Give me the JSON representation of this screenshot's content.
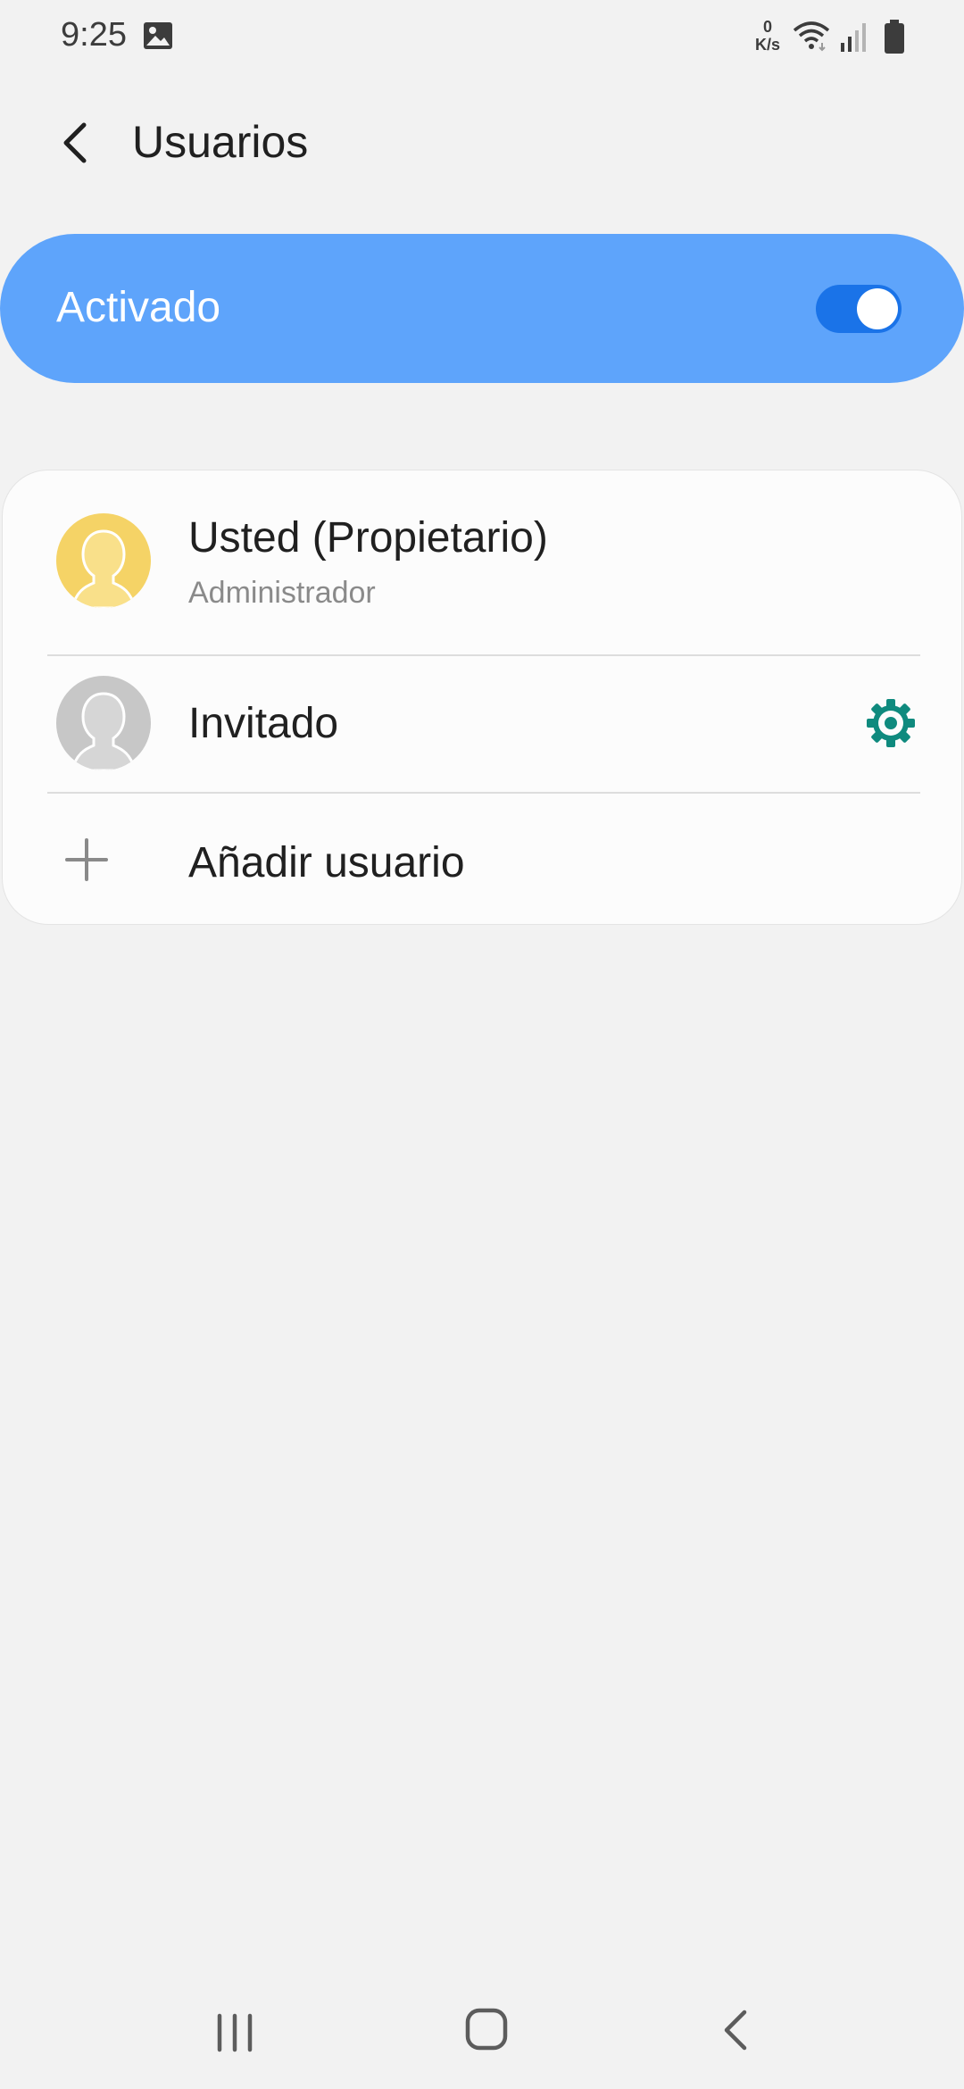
{
  "status_bar": {
    "time": "9:25",
    "net_speed_value": "0",
    "net_speed_unit": "K/s",
    "icons": [
      "gallery-icon",
      "wifi-icon",
      "signal-icon",
      "battery-icon"
    ]
  },
  "header": {
    "title": "Usuarios",
    "back_icon": "back-arrow-icon"
  },
  "master_switch": {
    "label": "Activado",
    "state": "on",
    "accent_color": "#5ea4fb"
  },
  "users": [
    {
      "name": "Usted (Propietario)",
      "role": "Administrador",
      "avatar_color": "#f5d366"
    },
    {
      "name": "Invitado",
      "settings_icon": "gear-icon",
      "avatar_color": "#c7c7c7"
    }
  ],
  "add_user": {
    "label": "Añadir usuario",
    "icon": "plus-icon"
  },
  "nav_bar": {
    "icons": [
      "recents-icon",
      "home-icon",
      "back-icon"
    ]
  }
}
